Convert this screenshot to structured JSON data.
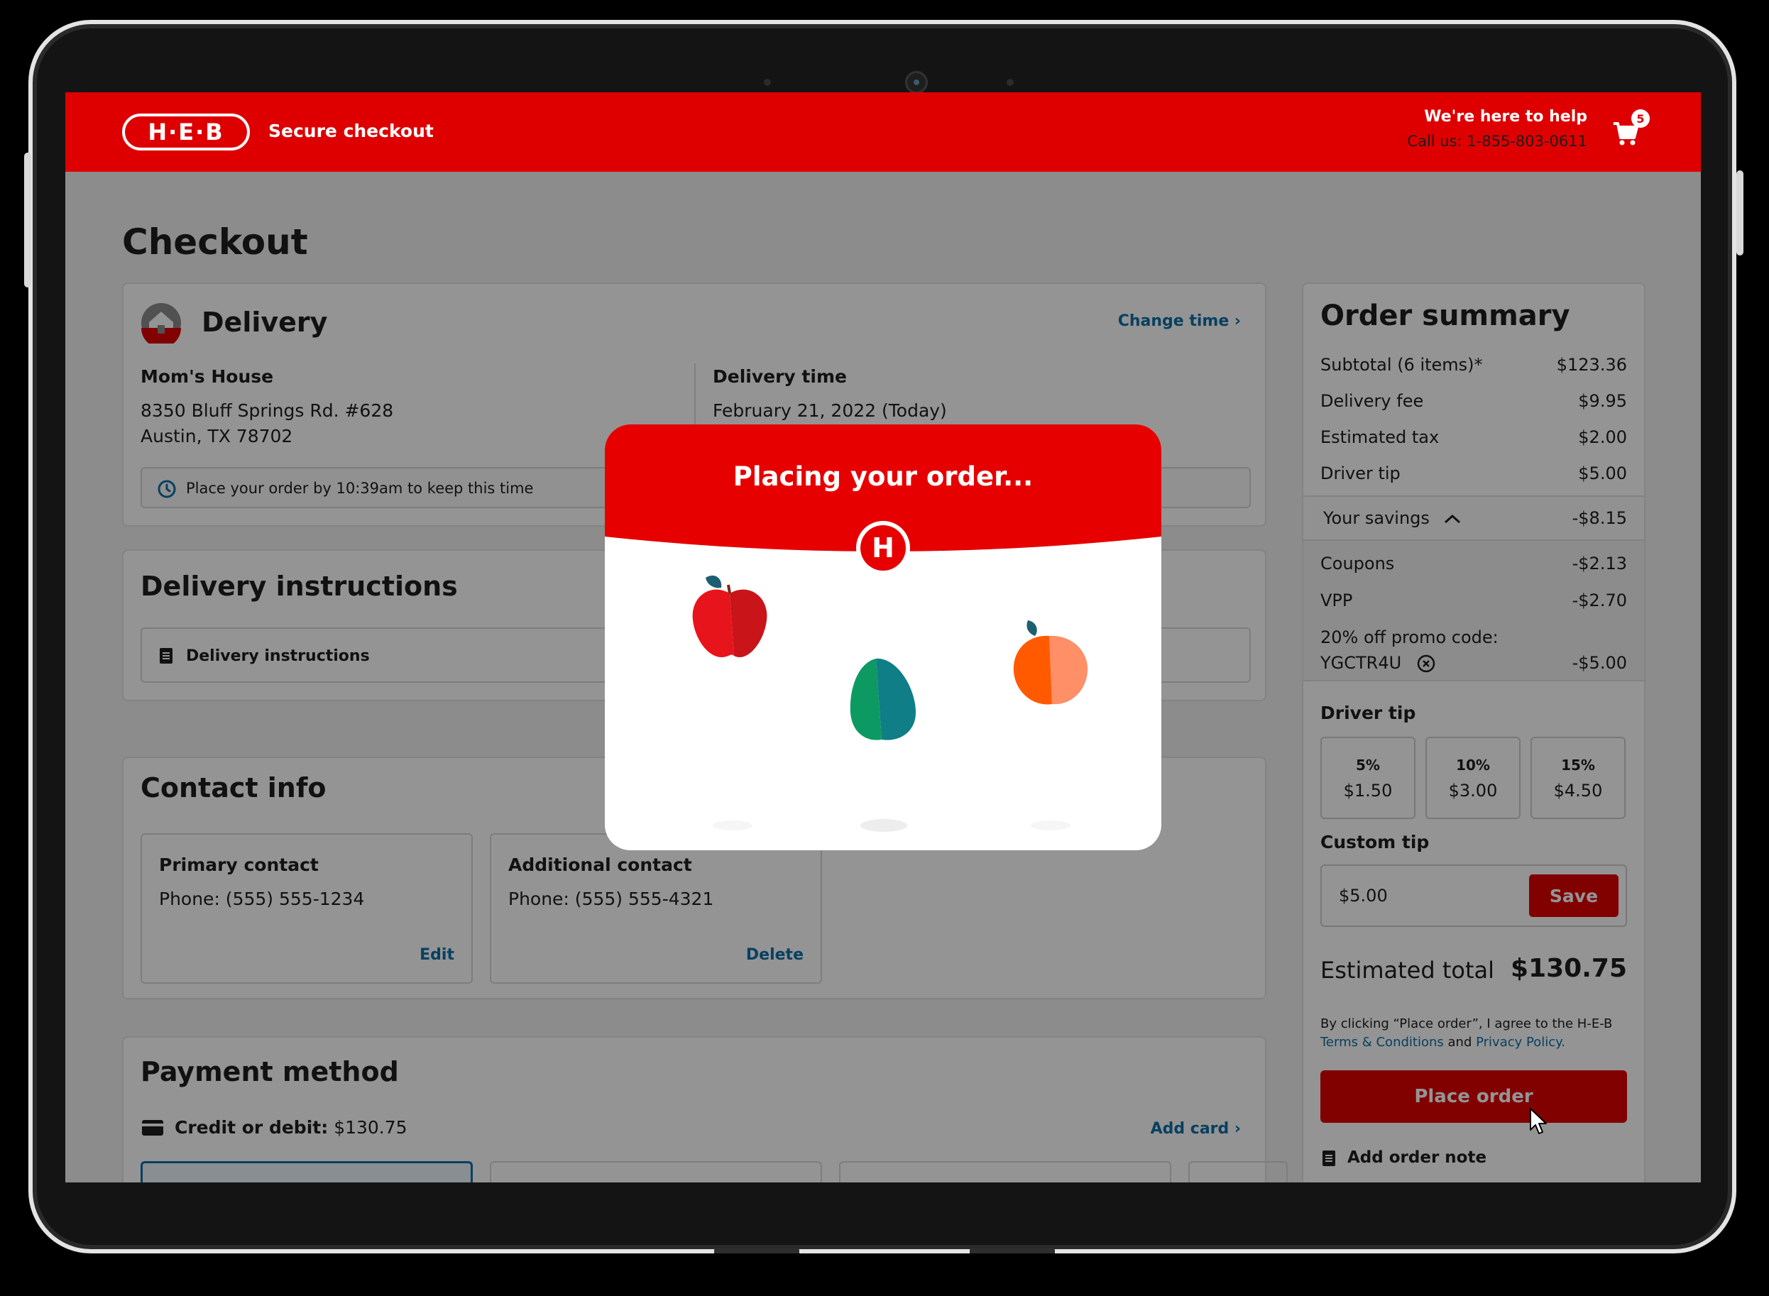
{
  "header": {
    "logo": "H·E·B",
    "secure_label": "Secure checkout",
    "help_title": "We're here to help",
    "help_phone": "Call us: 1-855-803-0611",
    "cart_count": "5"
  },
  "page_title": "Checkout",
  "delivery": {
    "title": "Delivery",
    "change_time": "Change time ›",
    "address_name": "Mom's House",
    "address_line1": "8350 Bluff Springs Rd. #628",
    "address_line2": "Austin, TX 78702",
    "time_label": "Delivery time",
    "time_value": "February 21, 2022 (Today)",
    "notice": "Place your order by 10:39am to keep this time"
  },
  "instructions": {
    "title": "Delivery instructions",
    "field_label": "Delivery instructions"
  },
  "contact": {
    "title": "Contact info",
    "primary_label": "Primary contact",
    "primary_phone": "Phone: (555) 555-1234",
    "primary_action": "Edit",
    "additional_label": "Additional contact",
    "additional_phone": "Phone: (555) 555-4321",
    "additional_action": "Delete"
  },
  "payment": {
    "title": "Payment method",
    "method_label": "Credit or debit:",
    "method_amount": "$130.75",
    "add_card": "Add card ›"
  },
  "summary": {
    "title": "Order summary",
    "rows": [
      {
        "label": "Subtotal (6 items)*",
        "value": "$123.36"
      },
      {
        "label": "Delivery fee",
        "value": "$9.95"
      },
      {
        "label": "Estimated tax",
        "value": "$2.00"
      },
      {
        "label": "Driver tip",
        "value": "$5.00"
      }
    ],
    "savings_label": "Your savings",
    "savings_value": "-$8.15",
    "savings_rows": [
      {
        "label": "Coupons",
        "value": "-$2.13"
      },
      {
        "label": "VPP",
        "value": "-$2.70"
      }
    ],
    "promo_label": "20% off promo code:",
    "promo_code": "YGCTR4U",
    "promo_value": "-$5.00",
    "tip_title": "Driver tip",
    "tips": [
      {
        "pct": "5%",
        "amt": "$1.50"
      },
      {
        "pct": "10%",
        "amt": "$3.00"
      },
      {
        "pct": "15%",
        "amt": "$4.50"
      }
    ],
    "custom_tip_label": "Custom tip",
    "custom_tip_value": "$5.00",
    "save_label": "Save",
    "total_label": "Estimated total",
    "total_value": "$130.75",
    "legal_text": "By clicking “Place order”, I agree to the H-E-B",
    "terms_link": "Terms & Conditions",
    "and_text": "and",
    "privacy_link": "Privacy Policy.",
    "place_order": "Place order",
    "order_note": "Add order note"
  },
  "modal": {
    "title": "Placing your order...",
    "badge": "H"
  },
  "colors": {
    "brand_red": "#de0000",
    "link_blue": "#0f6fa8",
    "overlay": "rgba(0,0,0,0.42)"
  }
}
